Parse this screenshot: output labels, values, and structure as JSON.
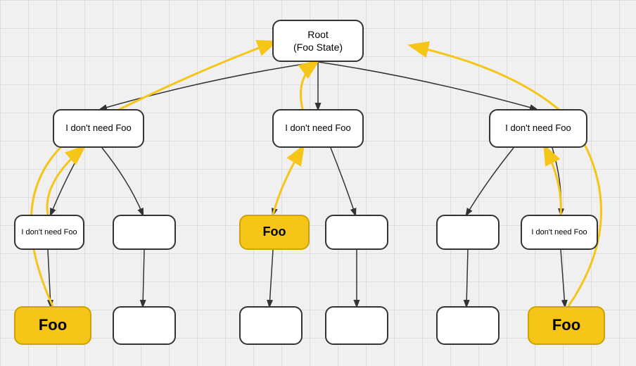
{
  "nodes": {
    "root": {
      "label": "Root\n(Foo State)"
    },
    "l2_left": {
      "label": "I don't need Foo"
    },
    "l2_center": {
      "label": "I don't need Foo"
    },
    "l2_right": {
      "label": "I don't need Foo"
    },
    "l3_1": {
      "label": "I don't need Foo"
    },
    "l3_2": {
      "label": ""
    },
    "l3_3": {
      "label": "Foo"
    },
    "l3_4": {
      "label": ""
    },
    "l3_5": {
      "label": ""
    },
    "l3_6": {
      "label": "I don't need Foo"
    },
    "l4_1": {
      "label": "Foo"
    },
    "l4_2": {
      "label": ""
    },
    "l4_3": {
      "label": ""
    },
    "l4_4": {
      "label": ""
    },
    "l4_5": {
      "label": ""
    },
    "l4_6": {
      "label": "Foo"
    }
  }
}
